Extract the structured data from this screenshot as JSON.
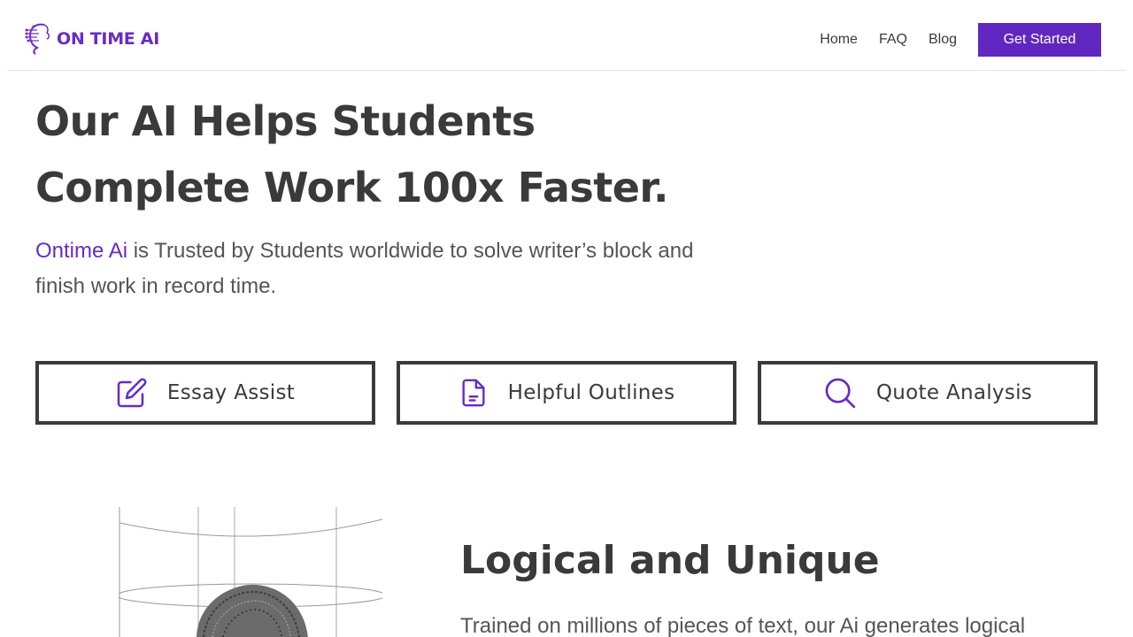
{
  "brand": {
    "name": "ON TIME AI",
    "accent": "#5f27c0"
  },
  "nav": {
    "items": [
      {
        "label": "Home"
      },
      {
        "label": "FAQ"
      },
      {
        "label": "Blog"
      }
    ],
    "cta_label": "Get Started"
  },
  "hero": {
    "title_line1": "Our AI Helps Students",
    "title_line2": "Complete Work 100x Faster.",
    "subtitle_brand": "Ontime Ai",
    "subtitle_rest": " is Trusted by Students worldwide to solve writer’s block and finish work in record time."
  },
  "features": [
    {
      "label": "Essay Assist",
      "icon": "pencil-square-icon"
    },
    {
      "label": "Helpful Outlines",
      "icon": "document-icon"
    },
    {
      "label": "Quote Analysis",
      "icon": "search-icon"
    }
  ],
  "section": {
    "title": "Logical and Unique",
    "body": "Trained on millions of pieces of text, our Ai generates logical"
  }
}
